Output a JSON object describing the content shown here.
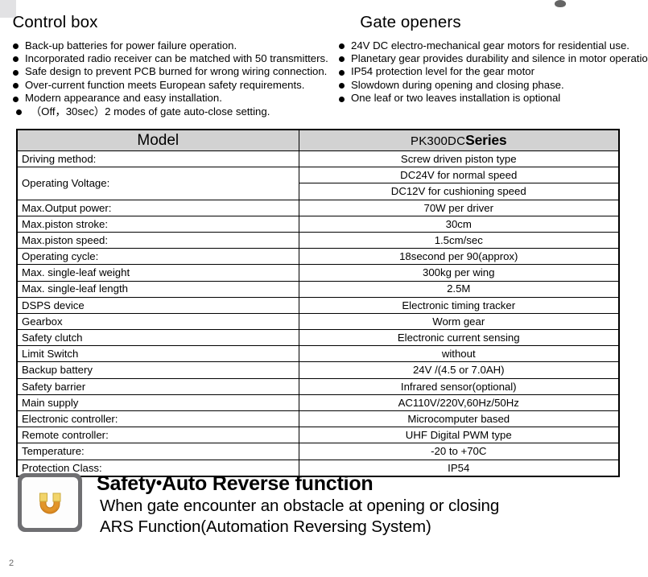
{
  "colors": {
    "header_row_gray": "#d2d2d2",
    "icon_frame_gray": "#6f6f72",
    "icon_magnet_orange": "#e2952a",
    "icon_magnet_yellow": "#f2d46a",
    "text_black": "#000000"
  },
  "sections": {
    "control_box": {
      "title": "Control box",
      "bullets": [
        "Back-up batteries for power failure operation.",
        "Incorporated radio receiver can be matched with 50 transmitters.",
        "Safe design to prevent PCB burned for wrong wiring connection.",
        "Over-current function meets European safety requirements.",
        "Modern appearance and easy installation.",
        "（Off，30sec）2  modes of gate auto-close setting."
      ]
    },
    "gate_openers": {
      "title": "Gate openers",
      "bullets": [
        "24V DC electro-mechanical gear motors for residential use.",
        "Planetary gear provides durability and silence in motor operation",
        "IP54 protection level for the gear motor",
        "Slowdown during opening and closing phase.",
        "One leaf or two leaves installation is optional"
      ]
    }
  },
  "spec_table": {
    "header": {
      "col1": "Model",
      "col2_code": "PK300DC",
      "col2_word": "Series"
    },
    "rows": [
      {
        "key": "Driving method:",
        "values": [
          "Screw driven piston type"
        ]
      },
      {
        "key": "Operating Voltage:",
        "values": [
          "DC24V for normal speed",
          "DC12V for cushioning speed"
        ]
      },
      {
        "key": "Max.Output power:",
        "values": [
          "70W per driver"
        ]
      },
      {
        "key": "Max.piston stroke:",
        "values": [
          "30cm"
        ]
      },
      {
        "key": "Max.piston speed:",
        "values": [
          "1.5cm/sec"
        ]
      },
      {
        "key": "Operating cycle:",
        "values": [
          "18second per 90(approx)"
        ]
      },
      {
        "key": "Max. single-leaf weight",
        "values": [
          "300kg per wing"
        ]
      },
      {
        "key": "Max. single-leaf length",
        "values": [
          "2.5M"
        ]
      },
      {
        "key": "DSPS device",
        "values": [
          "Electronic timing tracker"
        ]
      },
      {
        "key": "Gearbox",
        "values": [
          "Worm gear"
        ]
      },
      {
        "key": "Safety clutch",
        "values": [
          "Electronic current sensing"
        ]
      },
      {
        "key": "Limit Switch",
        "values": [
          "without"
        ]
      },
      {
        "key": "Backup battery",
        "values": [
          "24V /(4.5 or 7.0AH)"
        ]
      },
      {
        "key": "Safety barrier",
        "values": [
          "Infrared sensor(optional)"
        ]
      },
      {
        "key": "Main supply",
        "values": [
          "AC110V/220V,60Hz/50Hz"
        ]
      },
      {
        "key": "Electronic controller:",
        "values": [
          "Microcomputer based"
        ]
      },
      {
        "key": "Remote controller:",
        "values": [
          "UHF Digital PWM type"
        ]
      },
      {
        "key": "Temperature:",
        "values": [
          "-20 to +70C"
        ]
      },
      {
        "key": "Protection Class:",
        "values": [
          "IP54"
        ]
      }
    ]
  },
  "safety_section": {
    "icon_name": "magnet-horseshoe-icon",
    "title_prefix": "Safety",
    "title_separator": "•",
    "title_suffix": "Auto Reverse function",
    "lines": [
      "When gate encounter an obstacle at opening or closing",
      "ARS Function(Automation Reversing System)"
    ]
  },
  "footer": {
    "page_number": "2"
  }
}
